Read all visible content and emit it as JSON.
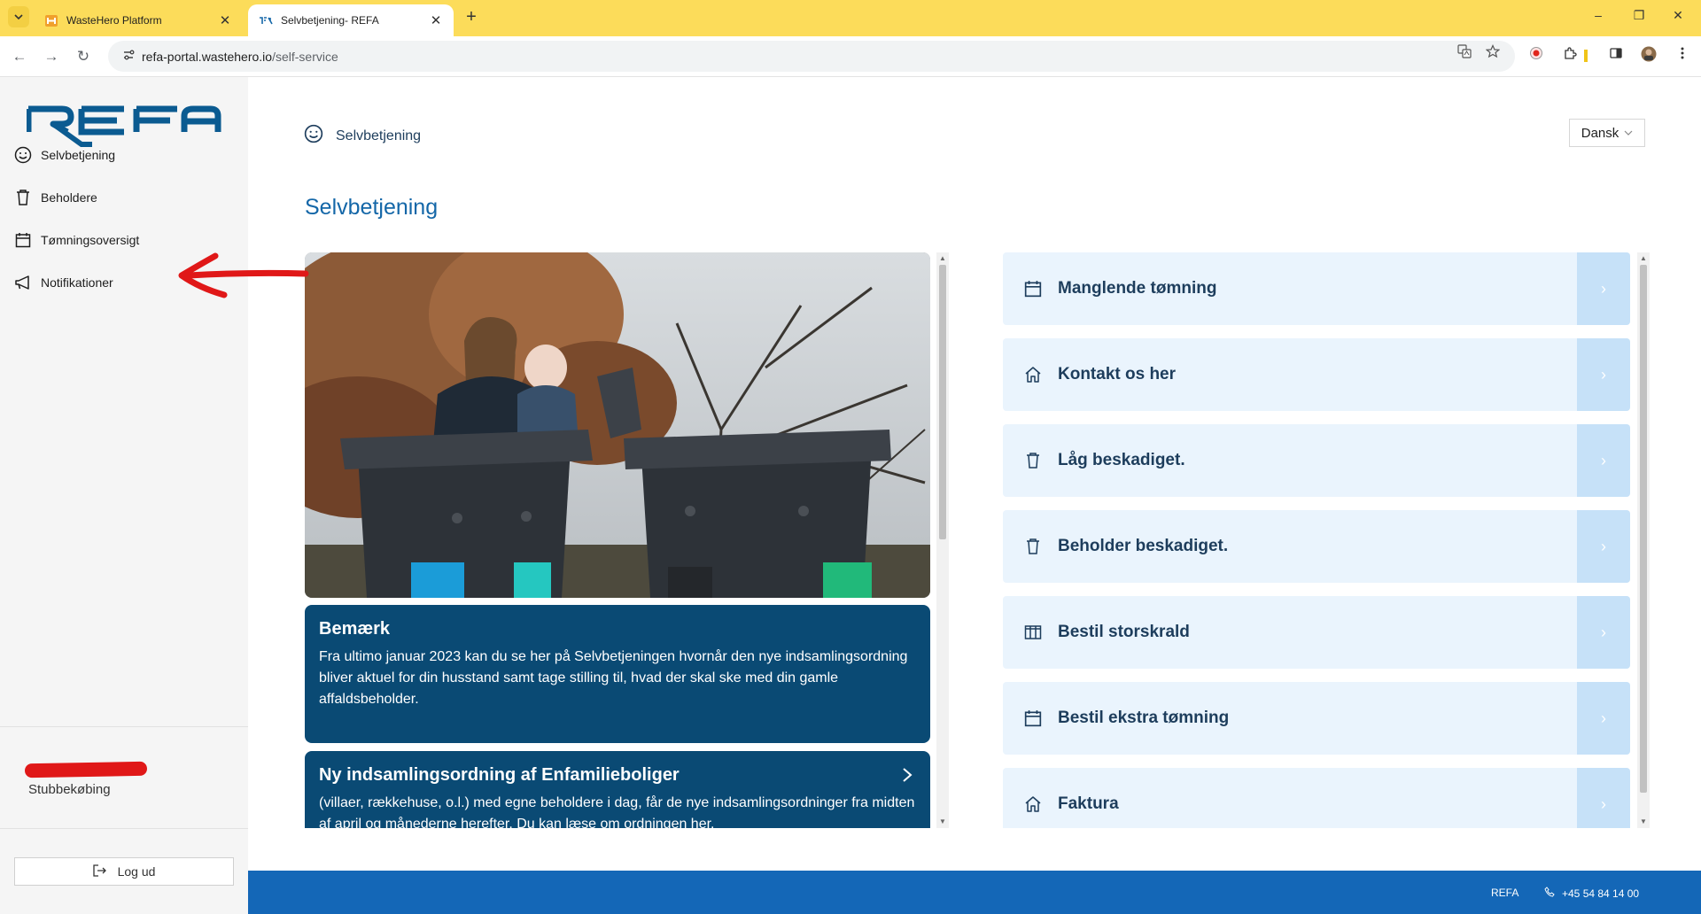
{
  "browser": {
    "tabs": [
      {
        "title": "WasteHero Platform",
        "active": false
      },
      {
        "title": "Selvbetjening- REFA",
        "active": true
      }
    ],
    "url_host": "refa-portal.wastehero.io",
    "url_path": "/self-service",
    "tab_close_glyph": "✕",
    "new_tab_glyph": "+",
    "back_glyph": "←",
    "forward_glyph": "→",
    "reload_glyph": "↻",
    "minimize_glyph": "–",
    "restore_glyph": "❐",
    "close_glyph": "✕"
  },
  "sidebar": {
    "logo_text": "REFA",
    "items": [
      {
        "label": "Selvbetjening",
        "icon": "smiley-icon"
      },
      {
        "label": "Beholdere",
        "icon": "trash-bin-icon"
      },
      {
        "label": "Tømningsoversigt",
        "icon": "calendar-icon"
      },
      {
        "label": "Notifikationer",
        "icon": "megaphone-icon"
      }
    ],
    "location": "Stubbekøbing",
    "logout_label": "Log ud"
  },
  "header": {
    "breadcrumb": "Selvbetjening",
    "language": "Dansk"
  },
  "main": {
    "title": "Selvbetjening",
    "news": [
      {
        "title": "Bemærk",
        "body": "Fra ultimo januar 2023 kan du se her på Selvbetjeningen hvornår den nye indsamlingsordning bliver aktuel for din husstand samt tage stilling til, hvad der skal ske med din gamle affaldsbeholder."
      },
      {
        "title": "Ny indsamlingsordning af Enfamilieboliger",
        "body": "(villaer, rækkehuse, o.l.) med egne beholdere i dag, får de nye indsamlingsordninger fra midten af april og månederne herefter. Du kan læse om ordningen her."
      }
    ],
    "services": [
      {
        "label": "Manglende tømning",
        "icon": "calendar-icon"
      },
      {
        "label": "Kontakt os her",
        "icon": "home-icon"
      },
      {
        "label": "Låg beskadiget.",
        "icon": "trash-bin-icon"
      },
      {
        "label": "Beholder beskadiget.",
        "icon": "trash-bin-icon"
      },
      {
        "label": "Bestil storskrald",
        "icon": "columns-icon"
      },
      {
        "label": "Bestil ekstra tømning",
        "icon": "calendar-icon"
      },
      {
        "label": "Faktura",
        "icon": "home-icon"
      }
    ]
  },
  "footer": {
    "brand": "REFA",
    "phone": "+45 54 84 14 00"
  },
  "colors": {
    "browser_accent": "#fcdc5a",
    "brand_blue": "#1467a8",
    "news_card": "#0a4a74",
    "service_bg": "#eaf4fd",
    "service_go": "#c6e1f8",
    "footer": "#1467b7",
    "annotation_red": "#e01818"
  }
}
